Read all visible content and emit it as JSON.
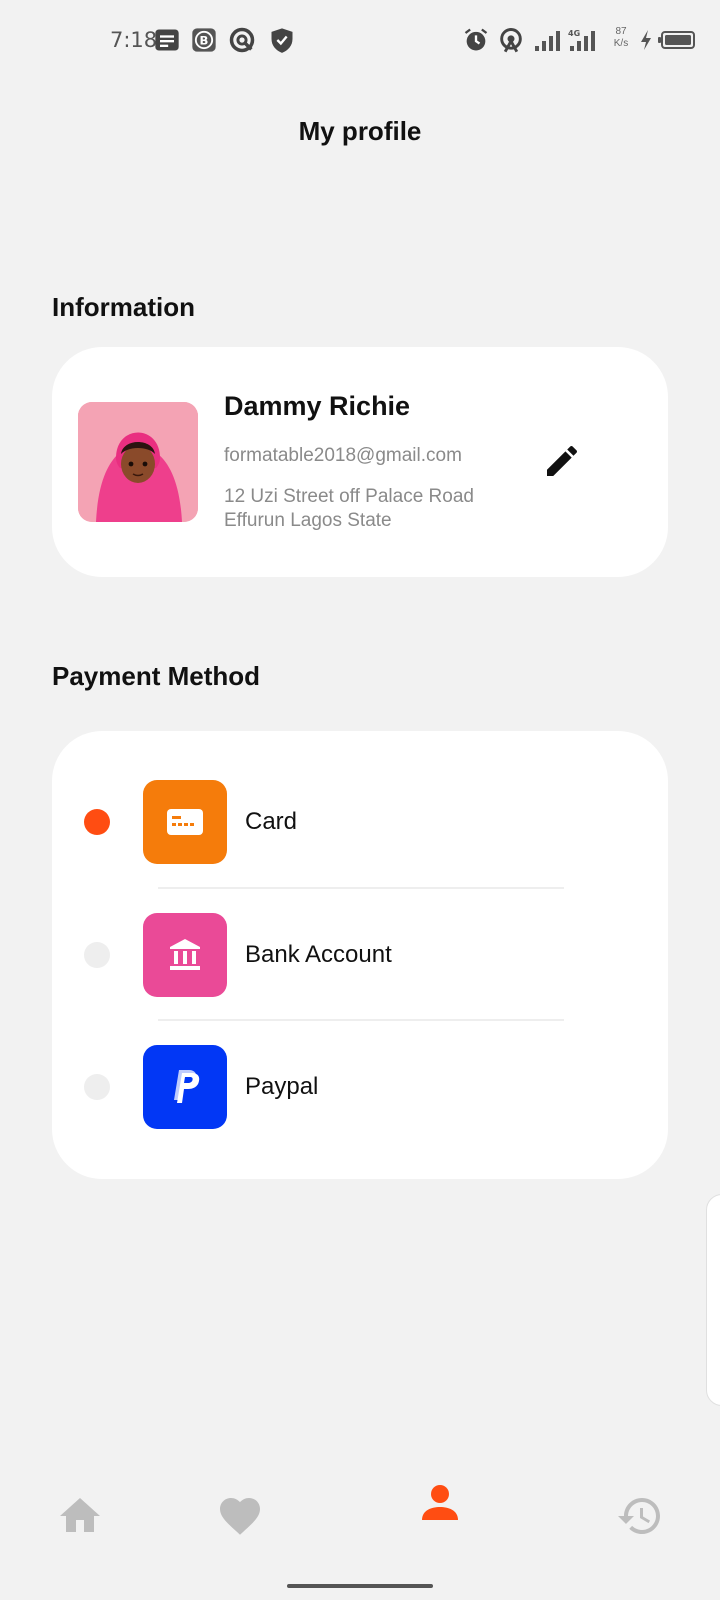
{
  "status_bar": {
    "time": "7:18",
    "network_speed_value": "87",
    "network_speed_unit": "K/s",
    "icons": [
      "notes-icon",
      "b-app-icon",
      "at-sign-icon",
      "shield-icon",
      "alarm-icon",
      "hotspot-icon",
      "signal-icon",
      "signal-4g-icon",
      "charging-icon",
      "battery-icon"
    ]
  },
  "header": {
    "title": "My profile"
  },
  "information": {
    "section_title": "Information",
    "name": "Dammy Richie",
    "email": "formatable2018@gmail.com",
    "address": "12 Uzi Street off  Palace Road Effurun Lagos State",
    "edit_icon": "pencil-icon"
  },
  "payment": {
    "section_title": "Payment Method",
    "methods": [
      {
        "label": "Card",
        "icon": "card-icon",
        "color": "#f57c0b",
        "selected": true
      },
      {
        "label": "Bank Account",
        "icon": "bank-icon",
        "color": "#ea4a97",
        "selected": false
      },
      {
        "label": "Paypal",
        "icon": "paypal-icon",
        "color": "#0237f5",
        "selected": false
      }
    ]
  },
  "bottom_nav": {
    "items": [
      {
        "icon": "home-icon",
        "active": false
      },
      {
        "icon": "heart-icon",
        "active": false
      },
      {
        "icon": "profile-icon",
        "active": true
      },
      {
        "icon": "history-icon",
        "active": false
      }
    ]
  },
  "colors": {
    "accent": "#ff4d12",
    "inactive_nav": "#bdbdbd",
    "background": "#f2f2f2"
  }
}
